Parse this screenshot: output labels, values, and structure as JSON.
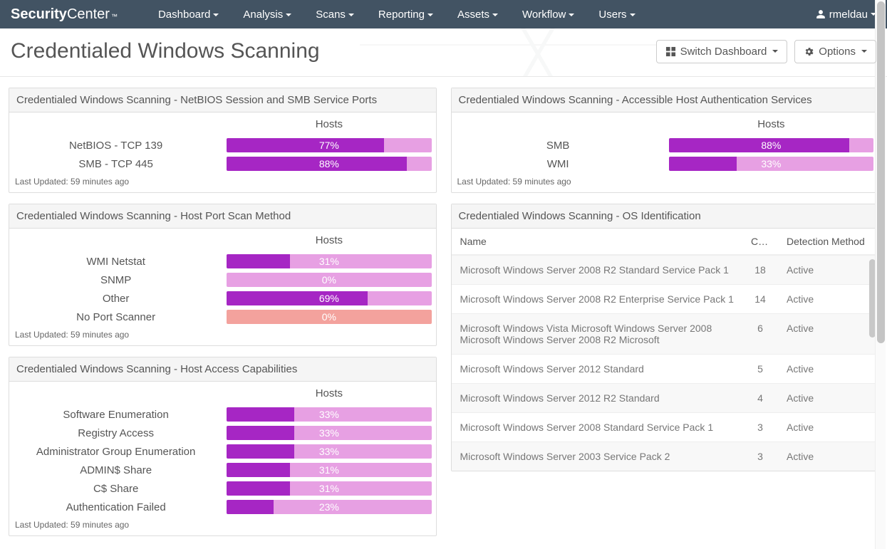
{
  "brand": {
    "part1": "Security",
    "part2": "Center",
    "tm": "™"
  },
  "nav": [
    "Dashboard",
    "Analysis",
    "Scans",
    "Reporting",
    "Assets",
    "Workflow",
    "Users"
  ],
  "user": "rmeldau",
  "page_title": "Credentialed Windows Scanning",
  "header_actions": {
    "switch": "Switch Dashboard",
    "options": "Options"
  },
  "col_label_hosts": "Hosts",
  "last_updated": "Last Updated: 59 minutes ago",
  "panel1": {
    "title": "Credentialed Windows Scanning - NetBIOS Session and SMB Service Ports",
    "rows": [
      {
        "label": "NetBIOS - TCP 139",
        "pct": 77
      },
      {
        "label": "SMB - TCP 445",
        "pct": 88
      }
    ]
  },
  "panel2": {
    "title": "Credentialed Windows Scanning - Host Port Scan Method",
    "rows": [
      {
        "label": "WMI Netstat",
        "pct": 31
      },
      {
        "label": "SNMP",
        "pct": 0
      },
      {
        "label": "Other",
        "pct": 69
      },
      {
        "label": "No Port Scanner",
        "pct": 0,
        "red": true
      }
    ]
  },
  "panel3": {
    "title": "Credentialed Windows Scanning - Host Access Capabilities",
    "rows": [
      {
        "label": "Software Enumeration",
        "pct": 33
      },
      {
        "label": "Registry Access",
        "pct": 33
      },
      {
        "label": "Administrator Group Enumeration",
        "pct": 33
      },
      {
        "label": "ADMIN$ Share",
        "pct": 31
      },
      {
        "label": "C$ Share",
        "pct": 31
      },
      {
        "label": "Authentication Failed",
        "pct": 23
      }
    ]
  },
  "panel4": {
    "title": "Credentialed Windows Scanning - Accessible Host Authentication Services",
    "rows": [
      {
        "label": "SMB",
        "pct": 88
      },
      {
        "label": "WMI",
        "pct": 33
      }
    ]
  },
  "panel5": {
    "title": "Credentialed Windows Scanning - OS Identification",
    "columns": {
      "name": "Name",
      "count": "C…",
      "method": "Detection Method"
    },
    "rows": [
      {
        "name": "Microsoft Windows Server 2008 R2 Standard Service Pack 1",
        "count": 18,
        "method": "Active"
      },
      {
        "name": "Microsoft Windows Server 2008 R2 Enterprise Service Pack 1",
        "count": 14,
        "method": "Active"
      },
      {
        "name": "Microsoft Windows Vista Microsoft Windows Server 2008 Microsoft Windows Server 2008 R2 Microsoft",
        "count": 6,
        "method": "Active"
      },
      {
        "name": "Microsoft Windows Server 2012 Standard",
        "count": 5,
        "method": "Active"
      },
      {
        "name": "Microsoft Windows Server 2012 R2 Standard",
        "count": 4,
        "method": "Active"
      },
      {
        "name": "Microsoft Windows Server 2008 Standard Service Pack 1",
        "count": 3,
        "method": "Active"
      },
      {
        "name": "Microsoft Windows Server 2003 Service Pack 2",
        "count": 3,
        "method": "Active"
      }
    ]
  },
  "chart_data": [
    {
      "type": "bar",
      "title": "NetBIOS Session and SMB Service Ports",
      "ylabel": "Hosts (%)",
      "categories": [
        "NetBIOS - TCP 139",
        "SMB - TCP 445"
      ],
      "values": [
        77,
        88
      ],
      "ylim": [
        0,
        100
      ]
    },
    {
      "type": "bar",
      "title": "Host Port Scan Method",
      "ylabel": "Hosts (%)",
      "categories": [
        "WMI Netstat",
        "SNMP",
        "Other",
        "No Port Scanner"
      ],
      "values": [
        31,
        0,
        69,
        0
      ],
      "ylim": [
        0,
        100
      ]
    },
    {
      "type": "bar",
      "title": "Host Access Capabilities",
      "ylabel": "Hosts (%)",
      "categories": [
        "Software Enumeration",
        "Registry Access",
        "Administrator Group Enumeration",
        "ADMIN$ Share",
        "C$ Share",
        "Authentication Failed"
      ],
      "values": [
        33,
        33,
        33,
        31,
        31,
        23
      ],
      "ylim": [
        0,
        100
      ]
    },
    {
      "type": "bar",
      "title": "Accessible Host Authentication Services",
      "ylabel": "Hosts (%)",
      "categories": [
        "SMB",
        "WMI"
      ],
      "values": [
        88,
        33
      ],
      "ylim": [
        0,
        100
      ]
    },
    {
      "type": "table",
      "title": "OS Identification",
      "columns": [
        "Name",
        "Count",
        "Detection Method"
      ],
      "rows": [
        [
          "Microsoft Windows Server 2008 R2 Standard Service Pack 1",
          18,
          "Active"
        ],
        [
          "Microsoft Windows Server 2008 R2 Enterprise Service Pack 1",
          14,
          "Active"
        ],
        [
          "Microsoft Windows Vista Microsoft Windows Server 2008 Microsoft Windows Server 2008 R2 Microsoft",
          6,
          "Active"
        ],
        [
          "Microsoft Windows Server 2012 Standard",
          5,
          "Active"
        ],
        [
          "Microsoft Windows Server 2012 R2 Standard",
          4,
          "Active"
        ],
        [
          "Microsoft Windows Server 2008 Standard Service Pack 1",
          3,
          "Active"
        ],
        [
          "Microsoft Windows Server 2003 Service Pack 2",
          3,
          "Active"
        ]
      ]
    }
  ]
}
